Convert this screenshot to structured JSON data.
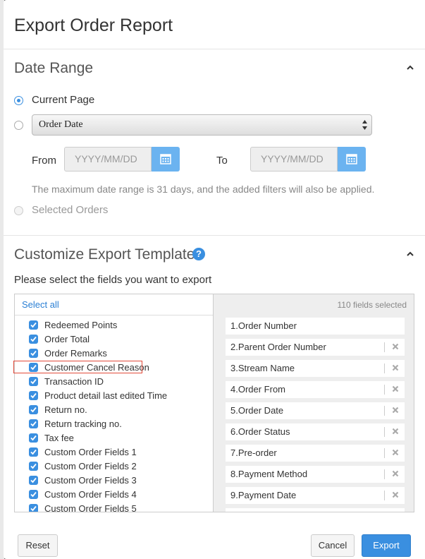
{
  "modal": {
    "title": "Export Order Report"
  },
  "date_range": {
    "heading": "Date Range",
    "options": {
      "current_page": "Current Page",
      "selected_orders": "Selected Orders"
    },
    "date_field_select": "Order Date",
    "from_label": "From",
    "to_label": "To",
    "from_placeholder": "YYYY/MM/DD",
    "to_placeholder": "YYYY/MM/DD",
    "hint": "The maximum date range is 31 days, and the added filters will also be applied."
  },
  "template": {
    "heading": "Customize Export Template",
    "help_glyph": "?",
    "instruction": "Please select the fields you want to export",
    "select_all": "Select all",
    "available_fields": [
      "Redeemed Points",
      "Order Total",
      "Order Remarks",
      "Customer Cancel Reason",
      "Transaction ID",
      "Product detail last edited Time",
      "Return no.",
      "Return tracking no.",
      "Tax fee",
      "Custom Order Fields 1",
      "Custom Order Fields 2",
      "Custom Order Fields 3",
      "Custom Order Fields 4",
      "Custom Order Fields 5"
    ],
    "fields_selected_count": "110 fields selected",
    "selected_fields": [
      "1.Order Number",
      "2.Parent Order Number",
      "3.Stream Name",
      "4.Order From",
      "5.Order Date",
      "6.Order Status",
      "7.Pre-order",
      "8.Payment Method",
      "9.Payment Date",
      ""
    ]
  },
  "footer": {
    "reset": "Reset",
    "cancel": "Cancel",
    "export": "Export"
  },
  "colors": {
    "accent": "#3a8fe0",
    "highlight_border": "#e24a3a"
  },
  "icons": {
    "calendar": "calendar-icon",
    "help": "question-circle-icon",
    "remove": "x-icon",
    "collapse": "chevron-up-icon"
  }
}
